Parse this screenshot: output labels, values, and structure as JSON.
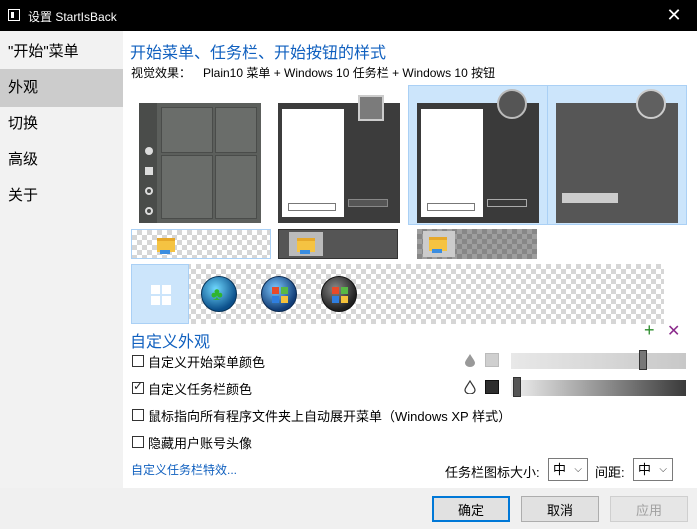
{
  "window": {
    "title": "设置 StartIsBack"
  },
  "sidebar": {
    "items": [
      {
        "label": "\"开始\"菜单"
      },
      {
        "label": "外观"
      },
      {
        "label": "切换"
      },
      {
        "label": "高级"
      },
      {
        "label": "关于"
      }
    ]
  },
  "main": {
    "heading": "开始菜单、任务栏、开始按钮的样式",
    "effect_label": "视觉效果：",
    "effect_value": "Plain10 菜单 + Windows 10 任务栏 + Windows 10 按钮"
  },
  "custom": {
    "title": "自定义外观",
    "options": [
      {
        "label": "自定义开始菜单颜色",
        "checked": false
      },
      {
        "label": "自定义任务栏颜色",
        "checked": true
      },
      {
        "label": "鼠标指向所有程序文件夹上自动展开菜单（Windows XP 样式）",
        "checked": false
      },
      {
        "label": "隐藏用户账号头像",
        "checked": false
      }
    ],
    "taskbar_effects_link": "自定义任务栏特效...",
    "icon_size_label": "任务栏图标大小:",
    "icon_size_value": "中",
    "spacing_label": "间距:",
    "spacing_value": "中"
  },
  "buttons": {
    "ok": "确定",
    "cancel": "取消",
    "apply": "应用"
  },
  "icons": {
    "app": "window-icon",
    "close": "close-icon",
    "add": "plus-icon",
    "remove": "x-icon",
    "user": "user-icon",
    "folder": "folder-icon",
    "drop": "drop-icon"
  },
  "colors": {
    "accent": "#1060bf",
    "selection": "#cce5fb",
    "green_add": "#2b8c2b",
    "purple_remove": "#8b2b8c"
  }
}
